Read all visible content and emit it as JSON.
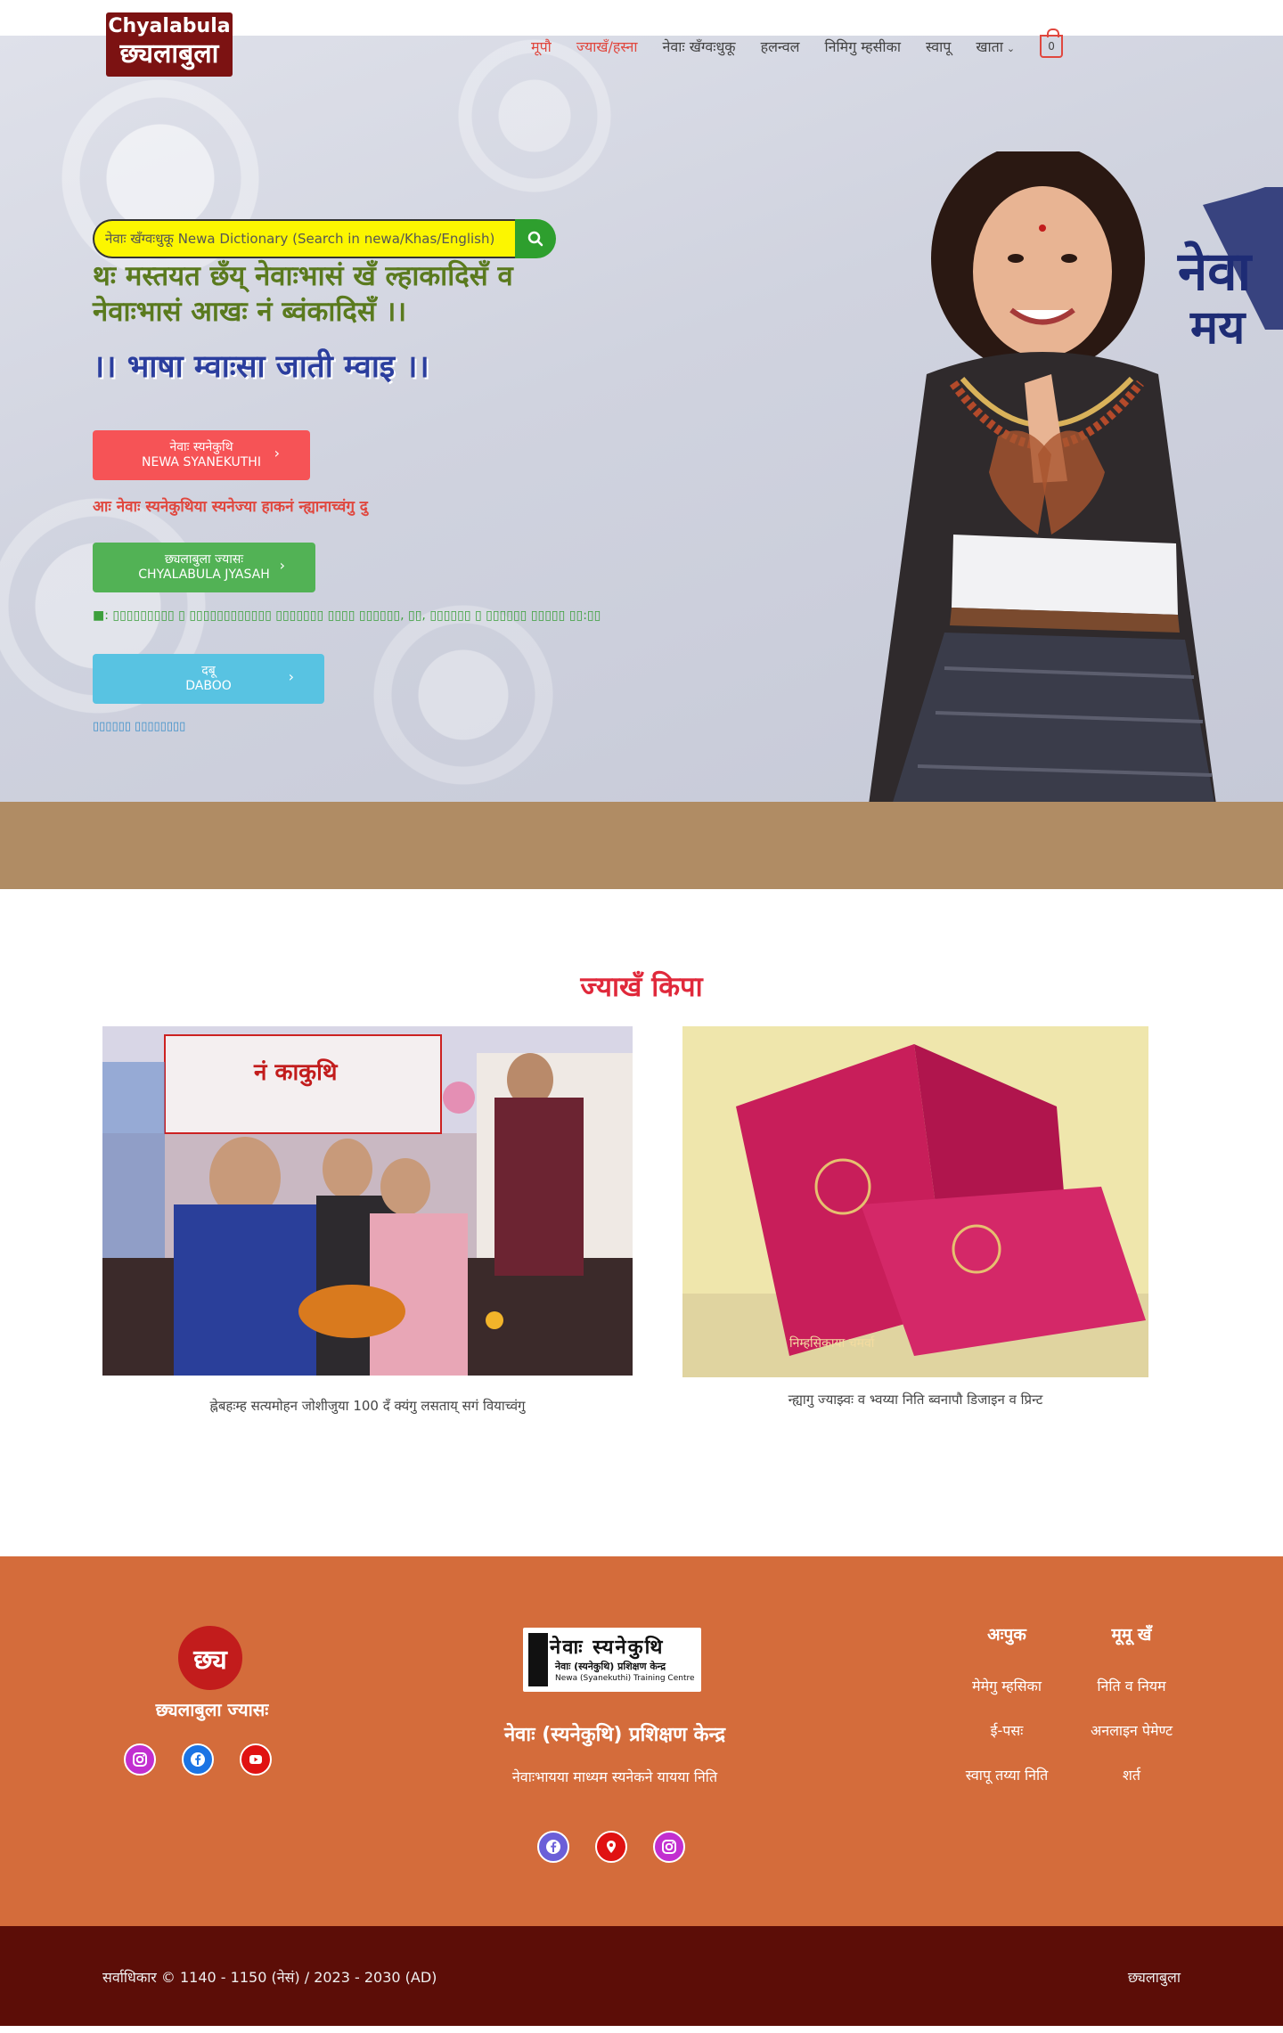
{
  "header": {
    "logo_en": "Chyalabula",
    "logo_ne": "छ्यलाबुला",
    "nav": [
      {
        "label": "मूपौ",
        "active": true
      },
      {
        "label": "ज्याखँ/हस्ना",
        "active": true
      },
      {
        "label": "नेवाः खँग्वःधुकू"
      },
      {
        "label": "हलन्वल"
      },
      {
        "label": "निमिगु म्हसीका"
      },
      {
        "label": "स्वापू"
      },
      {
        "label": "खाता"
      }
    ],
    "cart_count": "0"
  },
  "hero": {
    "search_placeholder": "नेवाः खँग्वःधुकू Newa Dictionary (Search in newa/Khas/English)",
    "headline": "थः मस्तयत छँय् नेवाःभासं खँ ल्हाकादिसँ व नेवाःभासं आखः नं ब्वंकादिसँ ।।",
    "slogan": "।। भाषा म्वाःसा जाती म्वाइ ।।",
    "btn1_line1": "नेवाः स्यनेकुथि",
    "btn1_line2": "NEWA SYANEKUTHI",
    "note1": "आः नेवाः स्यनेकुथिया स्यनेज्या हाकनं न्ह्यानाच्वंगु दु",
    "btn2_line1": "छ्यलाबुला ज्यासः",
    "btn2_line2": "CHYALABULA JYASAH",
    "note2": "■: ▯▯▯▯▯▯▯▯▯ ▯ ▯▯▯▯▯▯▯▯▯▯▯▯ ▯▯▯▯▯▯▯ ▯▯▯▯ ▯▯▯▯▯▯, ▯▯, ▯▯▯▯▯▯ ▯ ▯▯▯▯▯▯ ▯▯▯▯▯ ▯▯:▯▯",
    "btn3_line1": "दबू",
    "btn3_line2": "DABOO",
    "note3": "▯▯▯▯▯▯ ▯▯▯▯▯▯▯▯"
  },
  "news": {
    "title": "ज्याखँ किपा",
    "items": [
      {
        "caption": "ह्नेबहःम्ह सत्यमोहन जोशीजुया 100 दँ क्यंगु लसताय् सगं वियाच्वंगु"
      },
      {
        "caption": "न्ह्यागु ज्याझ्वः व भ्वय्या निति ब्वनापौ डिजाइन व प्रिन्ट"
      }
    ],
    "photo2_text": "निम्हसिकाया चमर्वा"
  },
  "footer": {
    "emblem_text": "छ्य",
    "org1": "छ्यलाबुला ज्यासः",
    "center_logo_big": "नेवाः स्यनेकुथि",
    "center_logo_sub1": "नेवाः (स्यनेकुथि) प्रशिक्षण केन्द्र",
    "center_logo_sub2": "Newa (Syanekuthi) Training Centre",
    "org2": "नेवाः (स्यनेकुथि) प्रशिक्षण केन्द्र",
    "org2_sub": "नेवाःभायया माध्यम स्यनेकने यायया निति",
    "col1_title": "अःपुक",
    "col1_items": [
      "मेमेगु म्हसिका",
      "ई-पसः",
      "स्वापू तय्या निति"
    ],
    "col2_title": "मूमू खँ",
    "col2_items": [
      "निति व नियम",
      "अनलाइन पेमेण्ट",
      "शर्त"
    ]
  },
  "copyright": {
    "left": "सर्वाधिकार © 1140 - 1150 (नेसं) / 2023 - 2030 (AD)",
    "right": "छ्यलाबुला"
  }
}
